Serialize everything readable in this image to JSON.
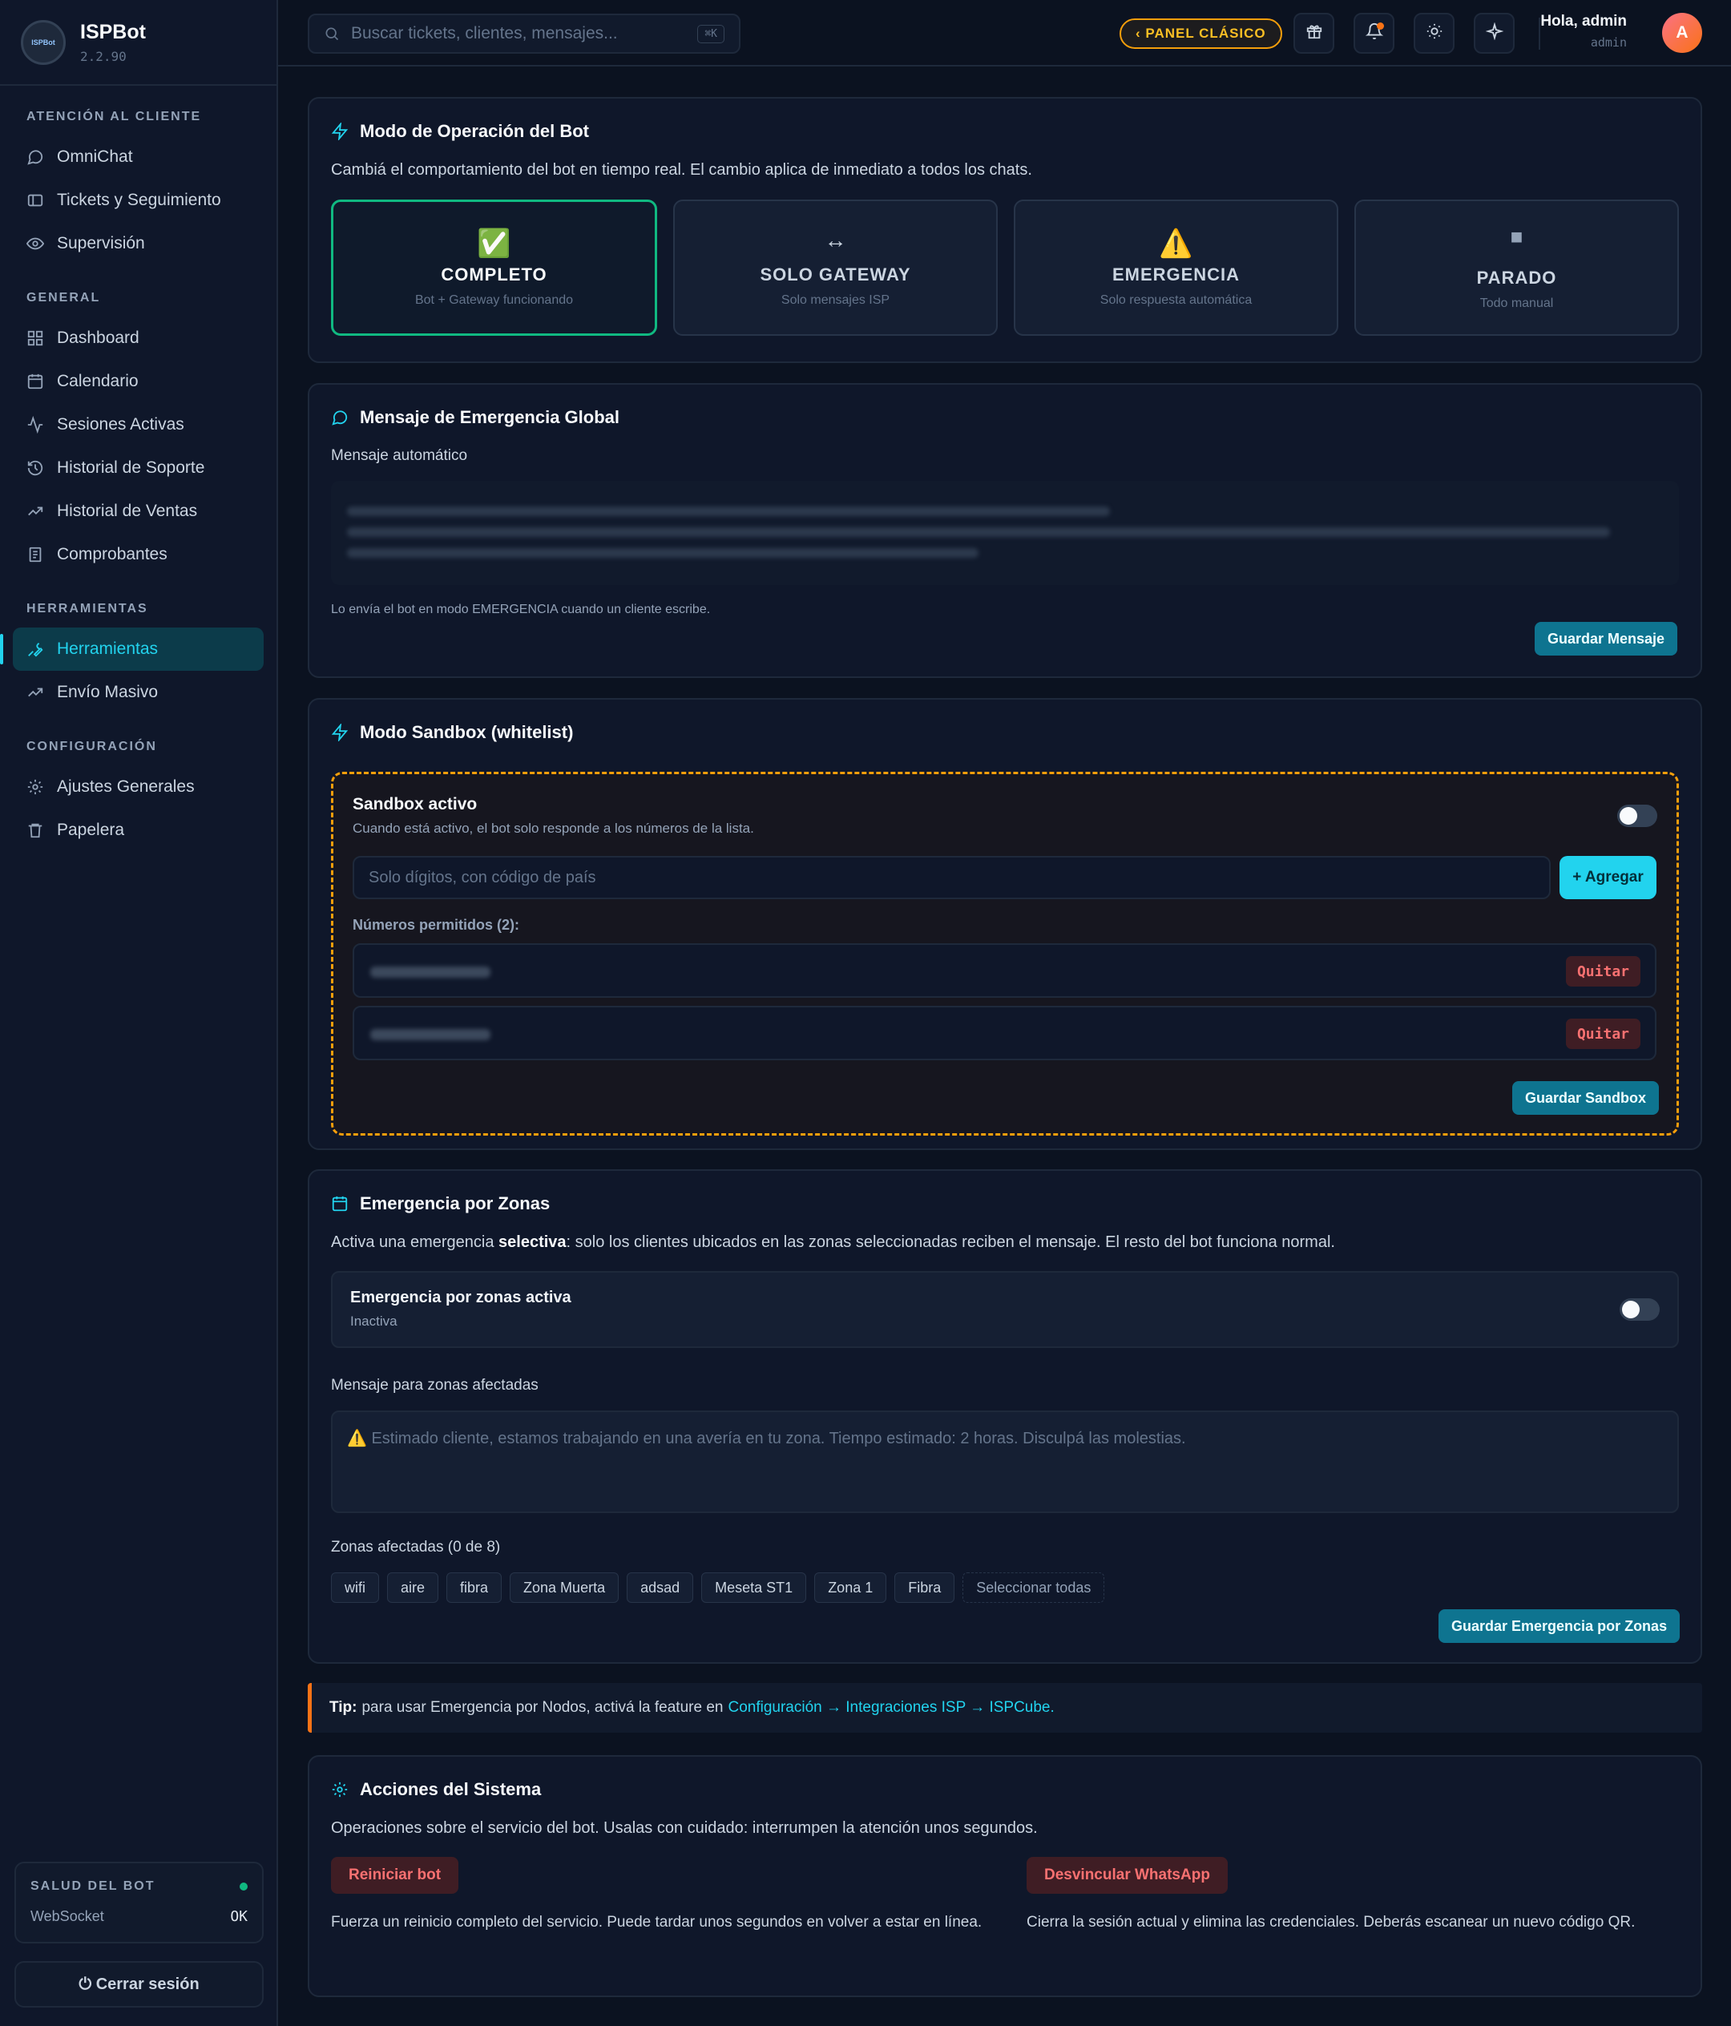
{
  "brand": {
    "name": "ISPBot",
    "version": "2.2.90",
    "logo_text": "ISPBot"
  },
  "sidebar": {
    "sections": [
      {
        "title": "ATENCIÓN AL CLIENTE",
        "items": [
          {
            "label": "OmniChat",
            "icon": "chat-icon"
          },
          {
            "label": "Tickets y Seguimiento",
            "icon": "ticket-icon"
          },
          {
            "label": "Supervisión",
            "icon": "eye-icon"
          }
        ]
      },
      {
        "title": "GENERAL",
        "items": [
          {
            "label": "Dashboard",
            "icon": "grid-icon"
          },
          {
            "label": "Calendario",
            "icon": "calendar-icon"
          },
          {
            "label": "Sesiones Activas",
            "icon": "activity-icon"
          },
          {
            "label": "Historial de Soporte",
            "icon": "history-icon"
          },
          {
            "label": "Historial de Ventas",
            "icon": "trend-icon"
          },
          {
            "label": "Comprobantes",
            "icon": "receipt-icon"
          }
        ]
      },
      {
        "title": "HERRAMIENTAS",
        "items": [
          {
            "label": "Herramientas",
            "icon": "wrench-icon",
            "active": true
          },
          {
            "label": "Envío Masivo",
            "icon": "trend-icon"
          }
        ]
      },
      {
        "title": "CONFIGURACIÓN",
        "items": [
          {
            "label": "Ajustes Generales",
            "icon": "gear-icon"
          },
          {
            "label": "Papelera",
            "icon": "trash-icon"
          }
        ]
      }
    ],
    "health": {
      "title": "SALUD DEL BOT",
      "label": "WebSocket",
      "value": "OK"
    },
    "logout": "⏻ Cerrar sesión"
  },
  "topbar": {
    "search_placeholder": "Buscar tickets, clientes, mensajes...",
    "search_kbd": "⌘K",
    "panel_button": "‹ PANEL CLÁSICO",
    "greeting": "Hola, admin",
    "role": "admin",
    "avatar": "A"
  },
  "bot_mode": {
    "title": "Modo de Operación del Bot",
    "description": "Cambiá el comportamiento del bot en tiempo real. El cambio aplica de inmediato a todos los chats.",
    "modes": [
      {
        "icon": "✅",
        "name": "COMPLETO",
        "sub": "Bot + Gateway funcionando",
        "active": true
      },
      {
        "icon": "↔",
        "name": "SOLO GATEWAY",
        "sub": "Solo mensajes ISP"
      },
      {
        "icon": "⚠️",
        "name": "EMERGENCIA",
        "sub": "Solo respuesta automática"
      },
      {
        "icon": "■",
        "name": "PARADO",
        "sub": "Todo manual"
      }
    ]
  },
  "emergency_msg": {
    "title": "Mensaje de Emergencia Global",
    "label": "Mensaje automático",
    "hint": "Lo envía el bot en modo EMERGENCIA cuando un cliente escribe.",
    "save": "Guardar Mensaje"
  },
  "sandbox": {
    "title": "Modo Sandbox (whitelist)",
    "active_title": "Sandbox activo",
    "active_sub": "Cuando está activo, el bot solo responde a los números de la lista.",
    "input_placeholder": "Solo dígitos, con código de país",
    "add": "+ Agregar",
    "allowed_label": "Números permitidos (2):",
    "remove": "Quitar",
    "save": "Guardar Sandbox"
  },
  "zones": {
    "title": "Emergencia por Zonas",
    "desc_pre": "Activa una emergencia ",
    "desc_bold": "selectiva",
    "desc_post": ": solo los clientes ubicados en las zonas seleccionadas reciben el mensaje. El resto del bot funciona normal.",
    "toggle_title": "Emergencia por zonas activa",
    "toggle_sub": "Inactiva",
    "msg_label": "Mensaje para zonas afectadas",
    "msg_placeholder": "⚠️ Estimado cliente, estamos trabajando en una avería en tu zona. Tiempo estimado: 2 horas. Disculpá las molestias.",
    "zones_label": "Zonas afectadas (0 de 8)",
    "chips": [
      "wifi",
      "aire",
      "fibra",
      "Zona Muerta",
      "adsad",
      "Meseta ST1",
      "Zona 1",
      "Fibra"
    ],
    "select_all": "Seleccionar todas",
    "save": "Guardar Emergencia por Zonas"
  },
  "tip": {
    "label": "Tip:",
    "text": "para usar Emergencia por Nodos, activá la feature en",
    "link": "Configuración → Integraciones ISP → ISPCube."
  },
  "actions": {
    "title": "Acciones del Sistema",
    "description": "Operaciones sobre el servicio del bot. Usalas con cuidado: interrumpen la atención unos segundos.",
    "restart": "Reiniciar bot",
    "restart_desc": "Fuerza un reinicio completo del servicio. Puede tardar unos segundos en volver a estar en línea.",
    "unlink": "Desvincular WhatsApp",
    "unlink_desc": "Cierra la sesión actual y elimina las credenciales. Deberás escanear un nuevo código QR."
  }
}
